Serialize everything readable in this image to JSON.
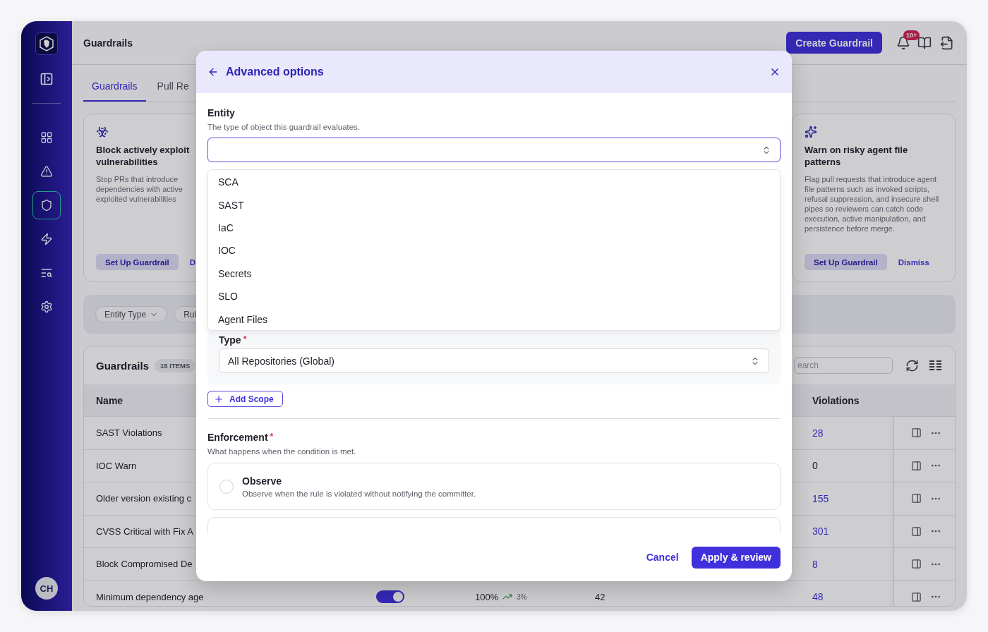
{
  "sidebar": {
    "nav_items": [
      {
        "selected": false
      },
      {
        "selected": false
      },
      {
        "selected": true
      },
      {
        "selected": false
      },
      {
        "selected": false
      },
      {
        "selected": false
      }
    ],
    "avatar": "CH"
  },
  "header": {
    "title": "Guardrails",
    "create_button": "Create Guardrail",
    "notification_badge": "10+"
  },
  "tabs": [
    {
      "label": "Guardrails",
      "selected": true
    },
    {
      "label": "Pull Re",
      "selected": false
    }
  ],
  "cards": [
    {
      "title": "Block actively exploit\nvulnerabilities",
      "description": "Stop PRs that introduce\ndependencies with active\nexploited vulnerabilities",
      "primary_action": "Set Up Guardrail",
      "secondary_action": "D"
    },
    {
      "title": "Warn on risky agent file patterns",
      "description": "Flag pull requests that introduce agent file patterns such as invoked scripts, refusal suppression, and insecure shell pipes so reviewers can catch code execution, active manipulation, and persistence before merge.",
      "primary_action": "Set Up Guardrail",
      "secondary_action": "Dismiss"
    }
  ],
  "filters": [
    {
      "label": "Entity Type",
      "dropdown": true
    },
    {
      "label": "Rul",
      "dropdown": false
    }
  ],
  "table": {
    "title": "Guardrails",
    "count": "15 ITEMS",
    "search_placeholder": "earch",
    "columns": [
      {
        "label": "Name"
      },
      {
        "label": "Violations"
      }
    ],
    "rows": [
      {
        "name": "SAST Violations",
        "violations": "28",
        "linked": true
      },
      {
        "name": "IOC Warn",
        "violations": "0",
        "linked": false
      },
      {
        "name": "Older version existing c",
        "violations": "155",
        "linked": true
      },
      {
        "name": "CVSS Critical with Fix A",
        "violations": "301",
        "linked": true
      },
      {
        "name": "Block Compromised De",
        "violations": "8",
        "linked": true
      },
      {
        "name": "Minimum dependency age",
        "enabled": true,
        "pass_rate": "100%",
        "trend": "3%",
        "count": "42",
        "violations": "48",
        "linked": true
      }
    ]
  },
  "modal": {
    "title": "Advanced options",
    "entity": {
      "label": "Entity",
      "description": "The type of object this guardrail evaluates.",
      "options": [
        {
          "label": "SCA"
        },
        {
          "label": "SAST"
        },
        {
          "label": "IaC"
        },
        {
          "label": "IOC"
        },
        {
          "label": "Secrets"
        },
        {
          "label": "SLO"
        },
        {
          "label": "Agent Files"
        }
      ]
    },
    "scope": {
      "type_label": "Type",
      "required_mark": "*",
      "type_value": "All Repositories (Global)"
    },
    "add_scope": "Add Scope",
    "enforcement": {
      "label": "Enforcement",
      "required_mark": "*",
      "description": "What happens when the condition is met.",
      "options": [
        {
          "kind": "radio",
          "title": "Observe",
          "description": "Observe when the rule is violated without notifying the committer.",
          "selected": false
        },
        {
          "kind": "edge"
        }
      ]
    },
    "cancel": "Cancel",
    "apply": "Apply & review"
  }
}
